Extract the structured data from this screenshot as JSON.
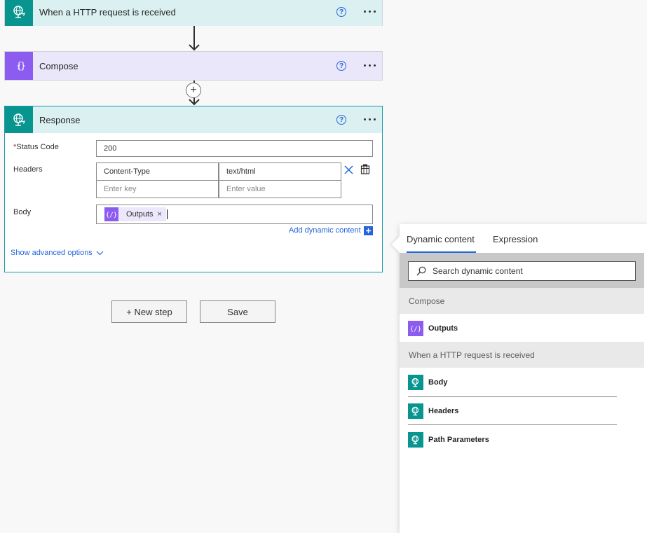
{
  "flow": {
    "trigger": {
      "title": "When a HTTP request is received",
      "icon": "globe-icon"
    },
    "compose": {
      "title": "Compose",
      "icon": "compose-icon"
    },
    "response": {
      "title": "Response",
      "icon": "globe-icon",
      "status_code": {
        "label": "Status Code",
        "required_mark": "*",
        "value": "200"
      },
      "headers": {
        "label": "Headers",
        "rows": [
          {
            "key": "Content-Type",
            "value": "text/html"
          }
        ],
        "key_placeholder": "Enter key",
        "value_placeholder": "Enter value"
      },
      "body": {
        "label": "Body",
        "token": "Outputs",
        "token_remove": "×"
      },
      "add_dynamic_content": "Add dynamic content",
      "show_advanced": "Show advanced options"
    },
    "help_symbol": "?",
    "add_step_symbol": "+"
  },
  "actions": {
    "new_step": "+ New step",
    "save": "Save"
  },
  "dynamic_panel": {
    "tabs": [
      "Dynamic content",
      "Expression"
    ],
    "active_tab": "Dynamic content",
    "search_placeholder": "Search dynamic content",
    "groups": [
      {
        "name": "Compose",
        "items": [
          {
            "label": "Outputs",
            "icon": "compose-icon"
          }
        ]
      },
      {
        "name": "When a HTTP request is received",
        "items": [
          {
            "label": "Body",
            "icon": "globe-icon"
          },
          {
            "label": "Headers",
            "icon": "globe-icon"
          },
          {
            "label": "Path Parameters",
            "icon": "globe-icon"
          }
        ]
      }
    ]
  },
  "colors": {
    "teal": "#09958f",
    "teal_light": "#daf0f1",
    "purple": "#8c5cf0",
    "purple_light": "#ebe7fb",
    "accent_blue": "#2266d9"
  }
}
